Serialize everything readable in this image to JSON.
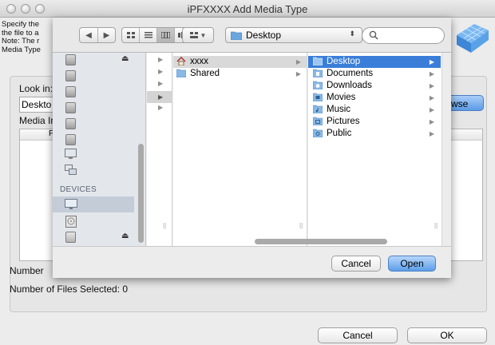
{
  "window": {
    "title": "iPFXXXX Add Media Type",
    "description_lines": [
      "Specify the",
      "the file to a",
      "Note: The r",
      "Media Type"
    ]
  },
  "form": {
    "look_in_label": "Look in:",
    "look_in_value": "Deskto",
    "media_info_label": "Media Ir",
    "list_header": "F",
    "browse_label": "wse",
    "number_of_files_label": "Number",
    "number_of_files_selected": "Number of Files Selected: 0",
    "cancel_label": "Cancel",
    "ok_label": "OK"
  },
  "sheet": {
    "location": "Desktop",
    "location_arrows": "⬍",
    "devices_header": "DEVICES",
    "column1": [
      {
        "name": "xxxx",
        "icon": "home-icon"
      },
      {
        "name": "Shared",
        "icon": "folder-icon"
      }
    ],
    "column2": [
      {
        "name": "Desktop",
        "icon": "desktop-folder-icon",
        "selected": true
      },
      {
        "name": "Documents",
        "icon": "documents-folder-icon"
      },
      {
        "name": "Downloads",
        "icon": "downloads-folder-icon"
      },
      {
        "name": "Movies",
        "icon": "movies-folder-icon"
      },
      {
        "name": "Music",
        "icon": "music-folder-icon"
      },
      {
        "name": "Pictures",
        "icon": "pictures-folder-icon"
      },
      {
        "name": "Public",
        "icon": "public-folder-icon"
      }
    ],
    "cancel_label": "Cancel",
    "open_label": "Open"
  },
  "colors": {
    "selection": "#3a7ed9",
    "sidebar_bg": "#e3e7ec",
    "default_button": "#5c9ee9"
  }
}
